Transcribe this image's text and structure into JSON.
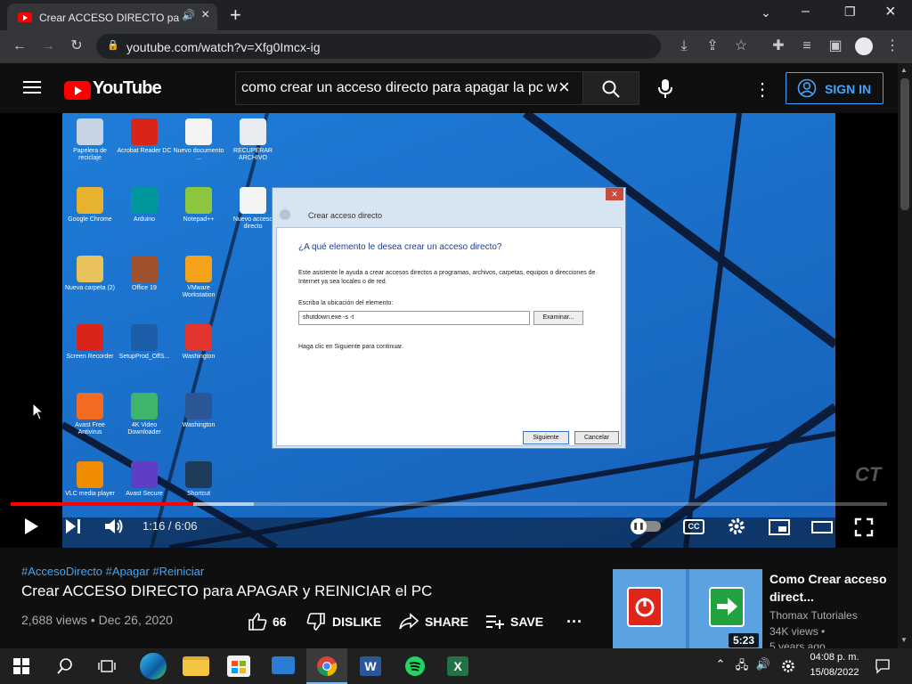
{
  "browser": {
    "tab_title": "Crear ACCESO DIRECTO pa",
    "url": "youtube.com/watch?v=Xfg0Imcx-ig"
  },
  "youtube": {
    "logo_text": "YouTube",
    "search_value": "como crear un acceso directo para apagar la pc w",
    "signin_label": "SIGN IN"
  },
  "video_frame": {
    "desktop_icons": [
      {
        "label": "Papelera de reciclaje",
        "color": "#c6d4e4"
      },
      {
        "label": "Acrobat Reader DC",
        "color": "#d9241a"
      },
      {
        "label": "Nuevo documento ...",
        "color": "#f4f4f4"
      },
      {
        "label": "RECUPERAR ARCHIVO",
        "color": "#e8ecf0"
      },
      {
        "label": "Google Chrome",
        "color": "#e7b32f"
      },
      {
        "label": "Arduino",
        "color": "#00979d"
      },
      {
        "label": "Notepad++",
        "color": "#8cc63f"
      },
      {
        "label": "Nuevo acceso directo",
        "color": "#f4f4f4"
      },
      {
        "label": "Nueva carpeta (2)",
        "color": "#e8c25a"
      },
      {
        "label": "Office 19",
        "color": "#a0522d"
      },
      {
        "label": "VMware Workstation",
        "color": "#f4a21c"
      },
      {
        "label": "Screen Recorder",
        "color": "#d9241a"
      },
      {
        "label": "SetupProd_OffS...",
        "color": "#1c5ea8"
      },
      {
        "label": "Washington",
        "color": "#e3342f"
      },
      {
        "label": "Avast Free Antivirus",
        "color": "#f26b21"
      },
      {
        "label": "4K Video Downloader",
        "color": "#3fb46d"
      },
      {
        "label": "Washington",
        "color": "#2b5797"
      },
      {
        "label": "VLC media player",
        "color": "#f08c00"
      },
      {
        "label": "Avast Secure",
        "color": "#5f3dc4"
      },
      {
        "label": "Shortcut",
        "color": "#1f3b5a"
      }
    ],
    "dialog": {
      "title": "Crear acceso directo",
      "heading": "¿A qué elemento le desea crear un acceso directo?",
      "description": "Este asistente le ayuda a crear accesos directos a programas, archivos, carpetas, equipos o direcciones de Internet ya sea locales o de red.",
      "location_label": "Escriba la ubicación del elemento:",
      "location_value": "shutdown.exe -s -t",
      "browse_label": "Examinar...",
      "hint": "Haga clic en Siguiente para continuar.",
      "next_label": "Siguiente",
      "cancel_label": "Cancelar"
    },
    "watermark": "CT"
  },
  "player": {
    "time_display": "1:16 / 6:06",
    "progress_played_fraction": 0.208,
    "progress_buffered_fraction": 0.277,
    "cc_label": "CC"
  },
  "video_info": {
    "hashtags": "#AccesoDirecto #Apagar #Reiniciar",
    "title": "Crear ACCESO DIRECTO para APAGAR y REINICIAR el PC",
    "meta": "2,688 views • Dec 26, 2020",
    "like_count": "66",
    "dislike_label": "DISLIKE",
    "share_label": "SHARE",
    "save_label": "SAVE"
  },
  "recommended": {
    "title": "Como Crear acceso direct...",
    "channel": "Thomax Tutoriales",
    "views": "34K views •",
    "age": "5 years ago",
    "duration": "5:23"
  },
  "taskbar": {
    "time": "04:08 p. m.",
    "date": "15/08/2022"
  },
  "colors": {
    "youtube_red": "#ff0000",
    "link_blue": "#3ea6ff"
  }
}
